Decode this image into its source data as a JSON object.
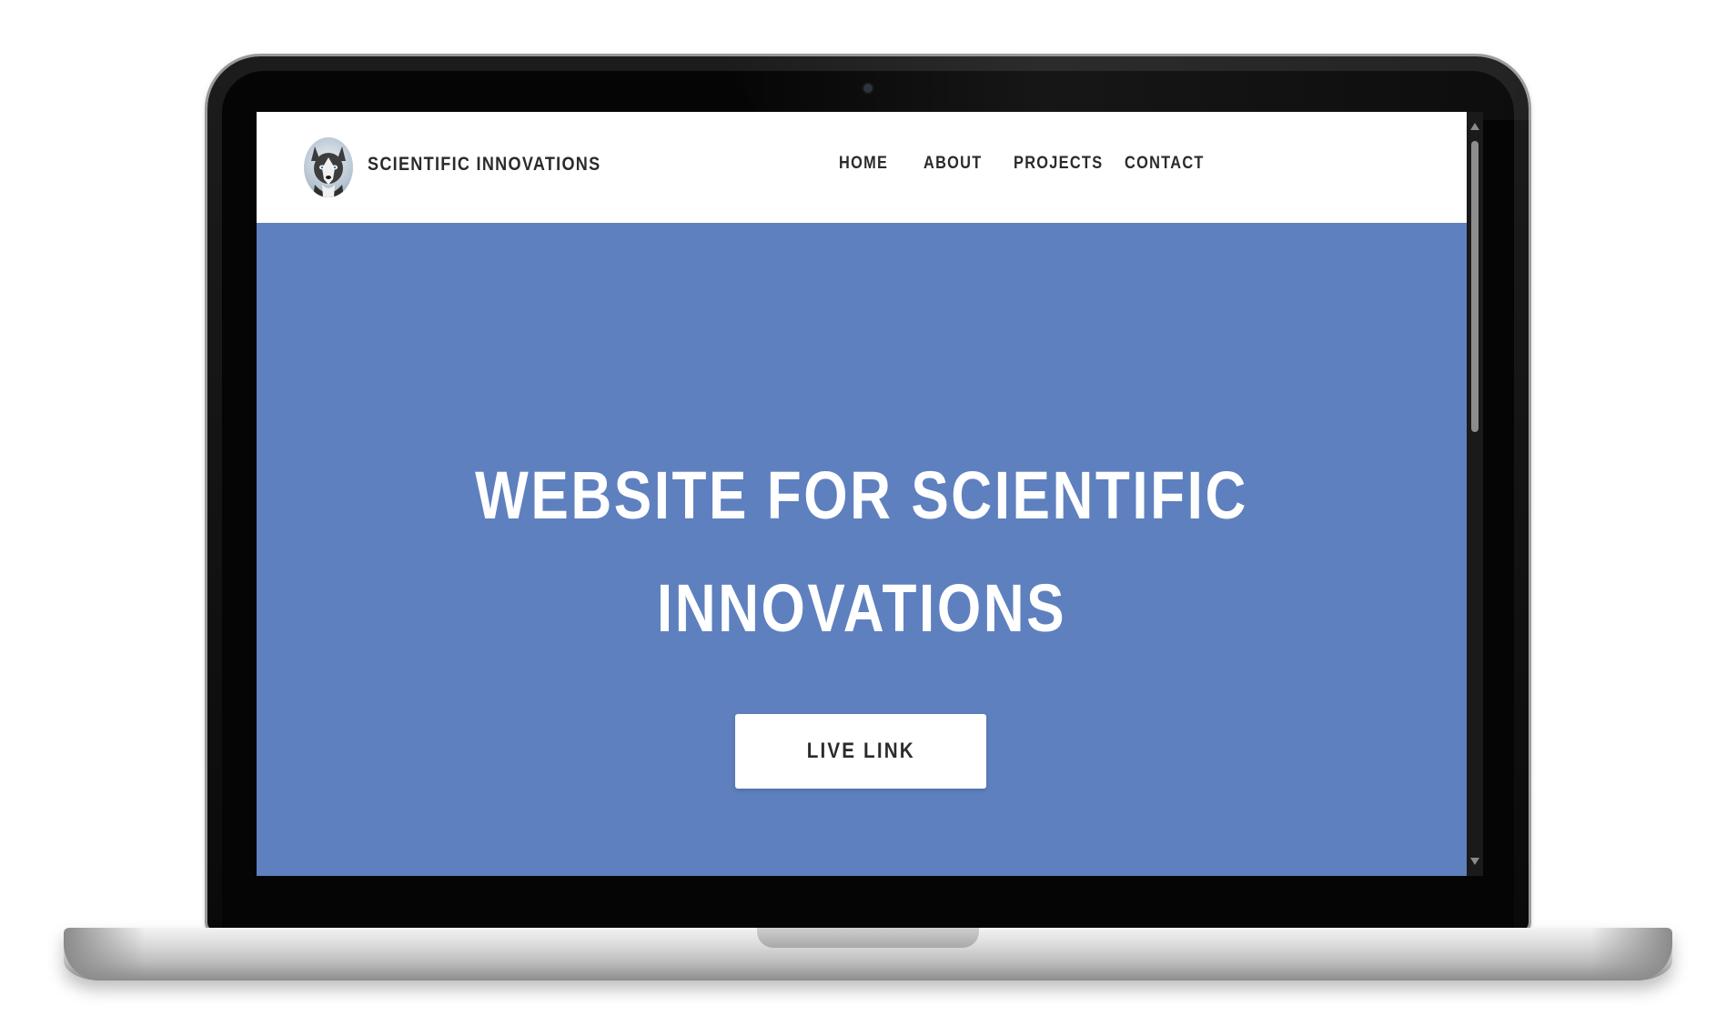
{
  "brand": {
    "name": "SCIENTIFIC INNOVATIONS",
    "logo_icon": "husky-dog-avatar"
  },
  "nav": {
    "items": [
      {
        "label": "HOME"
      },
      {
        "label": "ABOUT"
      },
      {
        "label": "PROJECTS"
      },
      {
        "label": "CONTACT"
      }
    ]
  },
  "hero": {
    "title_line1": "WEBSITE FOR SCIENTIFIC",
    "title_line2": "INNOVATIONS",
    "button_label": "LIVE LINK",
    "background_color": "#5f80bf"
  },
  "colors": {
    "hero_bg": "#5f80bf",
    "nav_bg": "#ffffff",
    "text_dark": "#2b2b2b",
    "hero_text": "#ffffff"
  }
}
